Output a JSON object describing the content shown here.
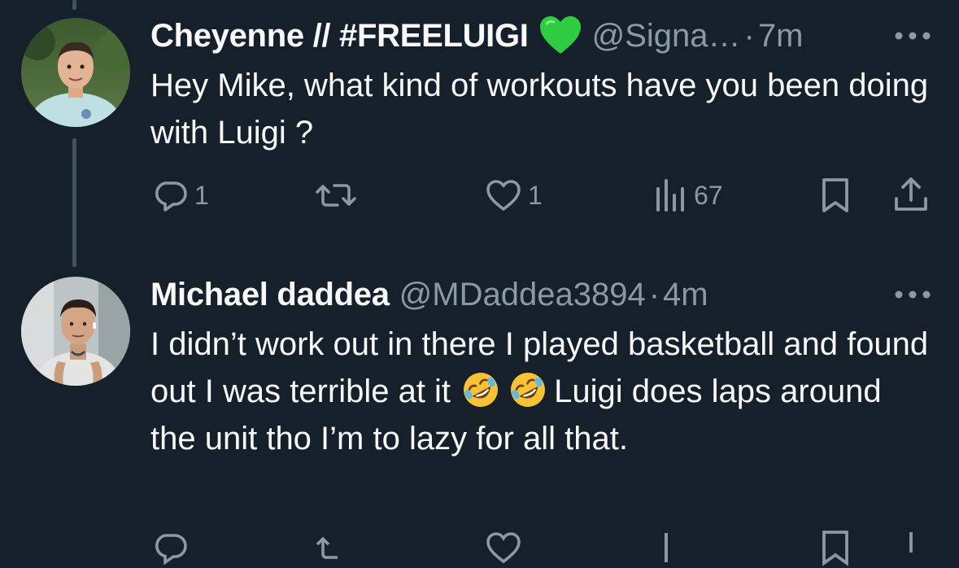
{
  "theme": {
    "background": "#15202b",
    "text": "#f7f9f9",
    "muted": "#8b98a5",
    "thread_line": "#42535f",
    "heart_green": "#2ecc40"
  },
  "tweets": [
    {
      "name": "Cheyenne // #FREELUIGI",
      "name_emoji": "green-heart",
      "handle": "@Signa…",
      "separator": "·",
      "time": "7m",
      "text": "Hey Mike, what kind of workouts have you been doing with Luigi ?",
      "actions": {
        "reply_count": "1",
        "retweet_count": "",
        "like_count": "1",
        "views_count": "67"
      }
    },
    {
      "name": "Michael daddea",
      "handle": "@MDaddea3894",
      "separator": "·",
      "time": "4m",
      "text_part1": "I didn’t work out in there I played basketball and found out I was terrible at it ",
      "emojis": [
        "rolling-on-floor-laughing",
        "rolling-on-floor-laughing"
      ],
      "text_part2": "Luigi does laps around the unit tho I’m to lazy for all that."
    }
  ]
}
